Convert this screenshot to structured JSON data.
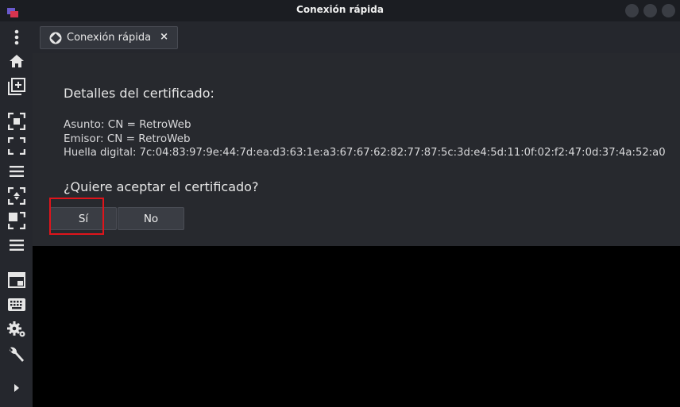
{
  "window": {
    "title": "Conexión rápida",
    "accent_color": "#e0141b"
  },
  "sidebar": {
    "icons": [
      "more-vertical-icon",
      "home-icon",
      "new-tab-icon",
      "focus-icon",
      "fullscreen-icon",
      "list-icon",
      "scale-icon",
      "resize-icon",
      "list-icon",
      "window-icon",
      "keyboard-icon",
      "settings-icon",
      "wrench-icon",
      "expand-arrow-icon"
    ]
  },
  "tab": {
    "label": "Conexión rápida",
    "close_symbol": "×"
  },
  "dialog": {
    "heading": "Detalles del certificado:",
    "subject": "Asunto: CN = RetroWeb",
    "issuer": "Emisor: CN = RetroWeb",
    "fingerprint": "Huella digital: 7c:04:83:97:9e:44:7d:ea:d3:63:1e:a3:67:67:62:82:77:87:5c:3d:e4:5d:11:0f:02:f2:47:0d:37:4a:52:a0",
    "question": "¿Quiere aceptar el certificado?",
    "yes_label": "Sí",
    "no_label": "No"
  }
}
